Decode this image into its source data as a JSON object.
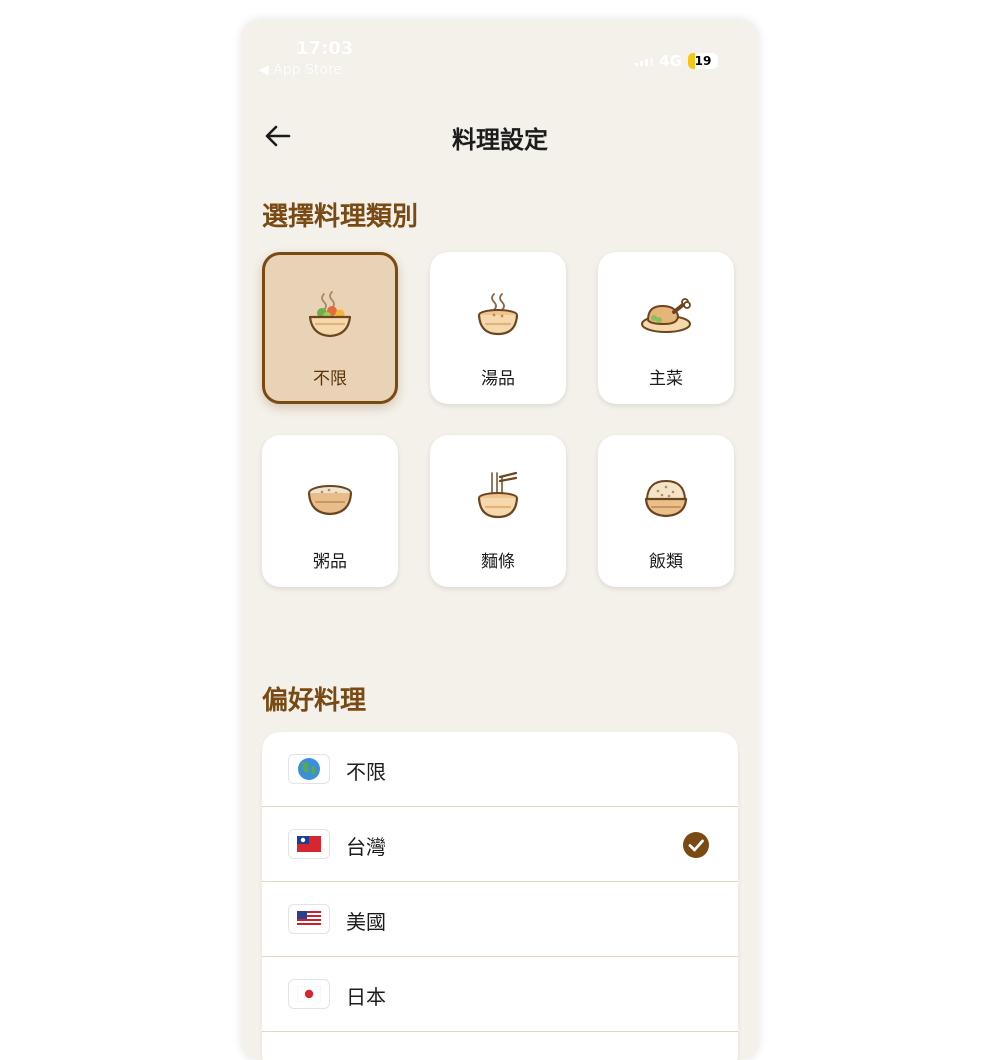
{
  "status_bar": {
    "time": "17:03",
    "back_app": "◀ App Store",
    "network": "4G",
    "battery_level": "19",
    "battery_color": "#f5c518"
  },
  "header": {
    "title": "料理設定",
    "back_icon": "arrow-left-icon"
  },
  "categories": {
    "title": "選擇料理類別",
    "items": [
      {
        "label": "不限",
        "icon": "mixed-bowl-icon",
        "selected": true
      },
      {
        "label": "湯品",
        "icon": "soup-bowl-icon",
        "selected": false
      },
      {
        "label": "主菜",
        "icon": "roast-chicken-icon",
        "selected": false
      },
      {
        "label": "粥品",
        "icon": "porridge-bowl-icon",
        "selected": false
      },
      {
        "label": "麵條",
        "icon": "noodle-bowl-icon",
        "selected": false
      },
      {
        "label": "飯類",
        "icon": "rice-bowl-icon",
        "selected": false
      }
    ]
  },
  "preferences": {
    "title": "偏好料理",
    "items": [
      {
        "label": "不限",
        "icon": "globe-icon",
        "checked": false
      },
      {
        "label": "台灣",
        "icon": "taiwan-flag-icon",
        "checked": true
      },
      {
        "label": "美國",
        "icon": "usa-flag-icon",
        "checked": false
      },
      {
        "label": "日本",
        "icon": "japan-flag-icon",
        "checked": false
      }
    ]
  },
  "colors": {
    "accent": "#7a4a14",
    "background": "#f4f1ea",
    "selected_card": "#e9d3b6"
  }
}
